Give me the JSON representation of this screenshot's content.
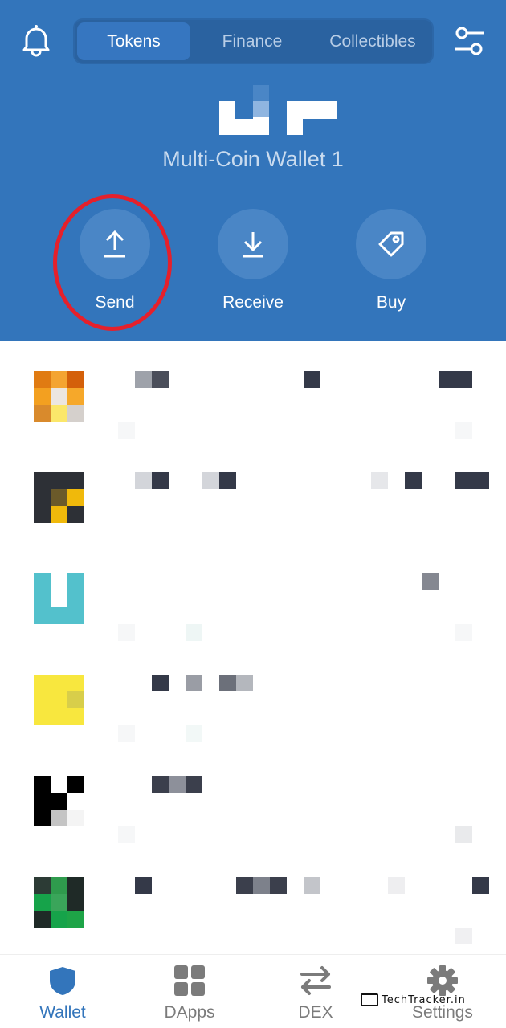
{
  "header": {
    "tabs": [
      {
        "label": "Tokens",
        "active": true
      },
      {
        "label": "Finance",
        "active": false
      },
      {
        "label": "Collectibles",
        "active": false
      }
    ],
    "wallet_name": "Multi-Coin Wallet 1",
    "actions": [
      {
        "label": "Send",
        "icon": "upload-arrow-icon",
        "highlighted": true
      },
      {
        "label": "Receive",
        "icon": "download-arrow-icon"
      },
      {
        "label": "Buy",
        "icon": "price-tag-icon"
      }
    ]
  },
  "token_list": {
    "rows": [
      {
        "icon": "token-icon-orange"
      },
      {
        "icon": "token-icon-dark-gold"
      },
      {
        "icon": "token-icon-teal"
      },
      {
        "icon": "token-icon-yellow"
      },
      {
        "icon": "token-icon-black"
      },
      {
        "icon": "token-icon-green"
      }
    ]
  },
  "bottom_nav": [
    {
      "label": "Wallet",
      "icon": "shield-icon",
      "active": true
    },
    {
      "label": "DApps",
      "icon": "grid-icon"
    },
    {
      "label": "DEX",
      "icon": "swap-arrows-icon"
    },
    {
      "label": "Settings",
      "icon": "gear-icon"
    }
  ],
  "watermark": {
    "text": "TechTracker.in"
  },
  "colors": {
    "brand_blue": "#3375bb",
    "highlight_red": "#e5202b",
    "active_nav": "#3375bb",
    "inactive_nav": "#7b7b7b"
  }
}
